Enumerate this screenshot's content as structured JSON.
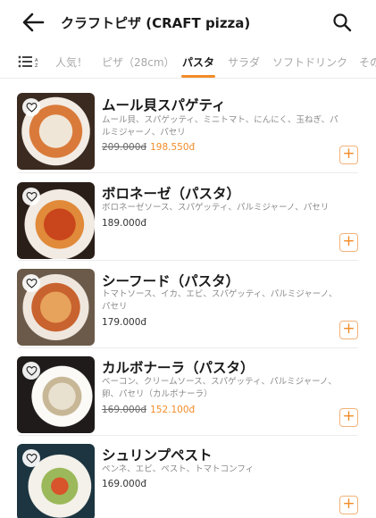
{
  "header": {
    "title": "クラフトピザ (CRAFT pizza)"
  },
  "tabs": [
    {
      "label": "人気！"
    },
    {
      "label": "ピザ（28cm）"
    },
    {
      "label": "パスタ"
    },
    {
      "label": "サラダ"
    },
    {
      "label": "ソフトドリンク"
    },
    {
      "label": "その"
    }
  ],
  "active_tab": "パスタ",
  "colors": {
    "accent": "#f28c28",
    "text": "#1a1a1a",
    "muted": "#8a8a8a"
  },
  "items": [
    {
      "name": "ムール貝スパゲティ",
      "description": "ムール貝、スパゲッティ、ミニトマト、にんにく、玉ねぎ、パルミジャーノ、パセリ",
      "old_price": "209.000đ",
      "price": "198.550đ"
    },
    {
      "name": "ボロネーゼ（パスタ）",
      "description": "ボロネーゼソース、スパゲッティ、パルミジャーノ、パセリ",
      "price": "189.000đ"
    },
    {
      "name": "シーフード（パスタ）",
      "description": "トマトソース、イカ、エビ、スパゲッティ、パルミジャーノ、パセリ",
      "price": "179.000đ"
    },
    {
      "name": "カルボナーラ（パスタ）",
      "description": "ベーコン、クリームソース、スパゲッティ、パルミジャーノ、卵、パセリ（カルボナーラ）",
      "old_price": "169.000đ",
      "price": "152.100đ"
    },
    {
      "name": "シュリンプペスト",
      "description": "ペンネ、エビ、ペスト、トマトコンフィ",
      "price": "169.000đ"
    }
  ],
  "add_label": "+"
}
